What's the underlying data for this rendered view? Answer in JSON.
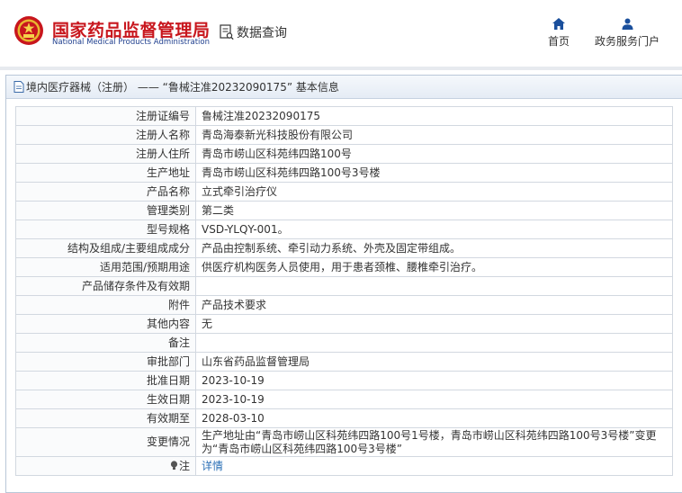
{
  "header": {
    "brand_cn": "国家药品监督管理局",
    "brand_en": "National Medical Products Administration",
    "db_query": "数据查询",
    "nav_home": "首页",
    "nav_portal": "政务服务门户"
  },
  "breadcrumb": "境内医疗器械（注册） —— “鲁械注准20232090175” 基本信息",
  "rows": [
    {
      "label": "注册证编号",
      "value": "鲁械注准20232090175"
    },
    {
      "label": "注册人名称",
      "value": "青岛海泰新光科技股份有限公司"
    },
    {
      "label": "注册人住所",
      "value": "青岛市崂山区科苑纬四路100号"
    },
    {
      "label": "生产地址",
      "value": "青岛市崂山区科苑纬四路100号3号楼"
    },
    {
      "label": "产品名称",
      "value": "立式牵引治疗仪"
    },
    {
      "label": "管理类别",
      "value": "第二类"
    },
    {
      "label": "型号规格",
      "value": "VSD-YLQY-001。"
    },
    {
      "label": "结构及组成/主要组成成分",
      "value": "产品由控制系统、牵引动力系统、外壳及固定带组成。"
    },
    {
      "label": "适用范围/预期用途",
      "value": "供医疗机构医务人员使用，用于患者颈椎、腰椎牵引治疗。"
    },
    {
      "label": "产品储存条件及有效期",
      "value": ""
    },
    {
      "label": "附件",
      "value": "产品技术要求"
    },
    {
      "label": "其他内容",
      "value": "无"
    },
    {
      "label": "备注",
      "value": ""
    },
    {
      "label": "审批部门",
      "value": "山东省药品监督管理局"
    },
    {
      "label": "批准日期",
      "value": "2023-10-19"
    },
    {
      "label": "生效日期",
      "value": "2023-10-19"
    },
    {
      "label": "有效期至",
      "value": "2028-03-10"
    },
    {
      "label": "变更情况",
      "value": "生产地址由“青岛市崂山区科苑纬四路100号1号楼，青岛市崂山区科苑纬四路100号3号楼”变更为“青岛市崂山区科苑纬四路100号3号楼”"
    }
  ],
  "note_row": {
    "label": "注",
    "link_text": "详情"
  },
  "colors": {
    "brand_red": "#c8161d",
    "brand_blue": "#1f3f8e",
    "link": "#2a6fb6",
    "nav_icon": "#1a4f9c"
  }
}
